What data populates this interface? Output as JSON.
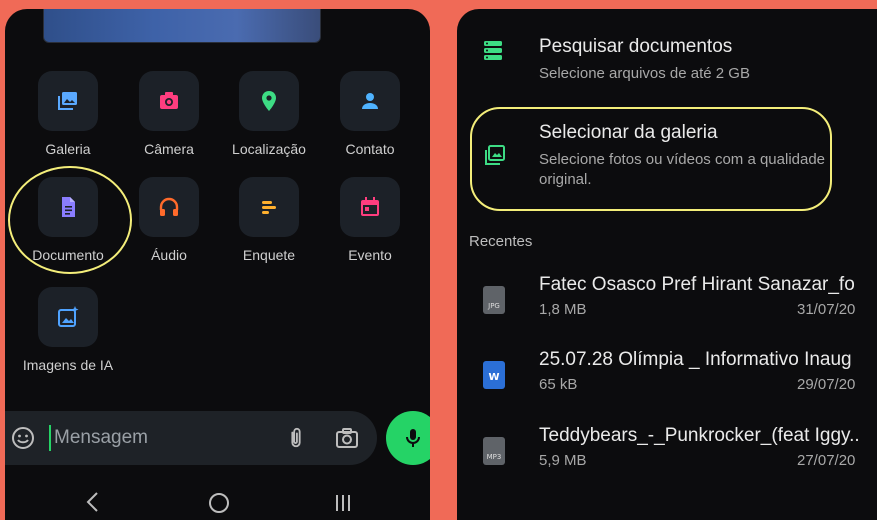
{
  "left_panel": {
    "attachments": [
      {
        "label": "Galeria",
        "icon": "gallery-icon",
        "color": "#5aa9ff"
      },
      {
        "label": "Câmera",
        "icon": "camera-icon",
        "color": "#ff3d7f"
      },
      {
        "label": "Localização",
        "icon": "location-pin-icon",
        "color": "#3ddc84"
      },
      {
        "label": "Contato",
        "icon": "contact-icon",
        "color": "#4fb3ff"
      },
      {
        "label": "Documento",
        "icon": "document-icon",
        "color": "#8a7dff"
      },
      {
        "label": "Áudio",
        "icon": "headphones-icon",
        "color": "#ff6a2b"
      },
      {
        "label": "Enquete",
        "icon": "poll-icon",
        "color": "#ffb02e"
      },
      {
        "label": "Evento",
        "icon": "calendar-icon",
        "color": "#ff3d7f"
      },
      {
        "label": "Imagens de IA",
        "icon": "ai-image-icon",
        "color": "#4fa3ff"
      }
    ],
    "message_placeholder": "Mensagem",
    "accent": "#25d366"
  },
  "right_panel": {
    "options": [
      {
        "title": "Pesquisar documentos",
        "subtitle": "Selecione arquivos de até 2 GB",
        "icon": "documents-list-icon"
      },
      {
        "title": "Selecionar da galeria",
        "subtitle": "Selecione fotos ou vídeos com a qualidade original.",
        "icon": "gallery-select-icon"
      }
    ],
    "recent_header": "Recentes",
    "files": [
      {
        "name": "Fatec Osasco Pref Hirant Sanazar_fo",
        "size": "1,8 MB",
        "date": "31/07/20",
        "type": "JPG"
      },
      {
        "name": "25.07.28 Olímpia _ Informativo  Inaug",
        "size": "65 kB",
        "date": "29/07/20",
        "type": "W"
      },
      {
        "name": "Teddybears_-_Punkrocker_(feat Iggy..",
        "size": "5,9 MB",
        "date": "27/07/20",
        "type": "MP3"
      }
    ],
    "highlight_color": "#f4ee7a"
  }
}
